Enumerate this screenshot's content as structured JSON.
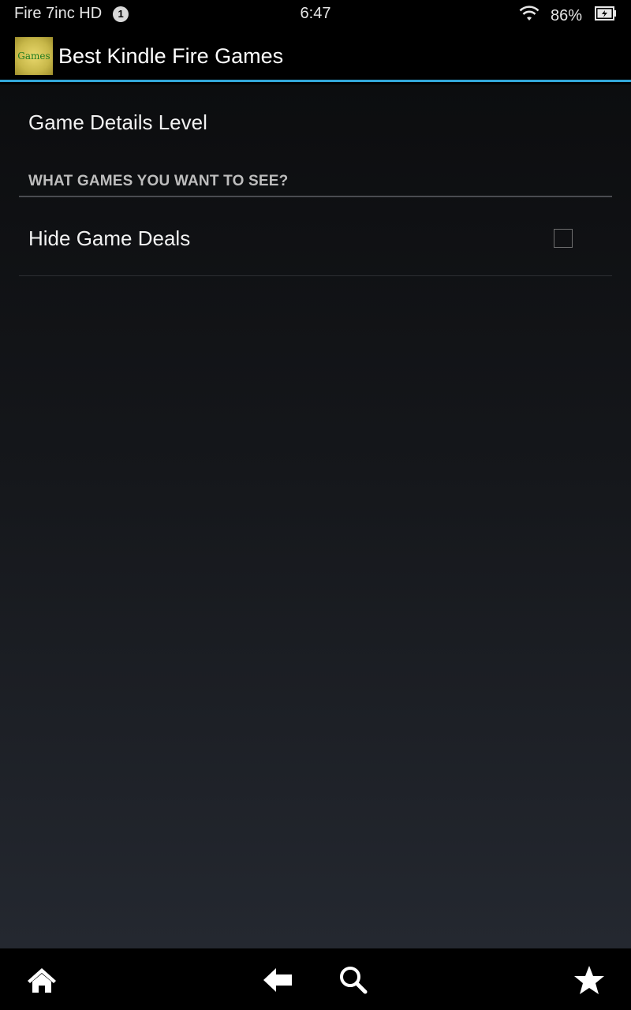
{
  "status_bar": {
    "device_name": "Fire 7inc HD",
    "notification_count": "1",
    "time": "6:47",
    "battery": "86%",
    "icons": [
      "wifi-icon",
      "battery-icon"
    ]
  },
  "action_bar": {
    "app_icon_text": "Games",
    "title": "Best Kindle Fire Games"
  },
  "preferences": {
    "game_details_level": "Game Details Level",
    "category_title": "WHAT GAMES YOU WANT TO SEE?",
    "hide_game_deals": {
      "label": "Hide Game Deals",
      "checked": false
    }
  },
  "nav_bar": {
    "icons": [
      "home-icon",
      "back-icon",
      "search-icon",
      "favorites-icon"
    ]
  },
  "colors": {
    "accent": "#33a7d9",
    "background_top": "#0c0d0f",
    "background_bottom": "#242830"
  }
}
